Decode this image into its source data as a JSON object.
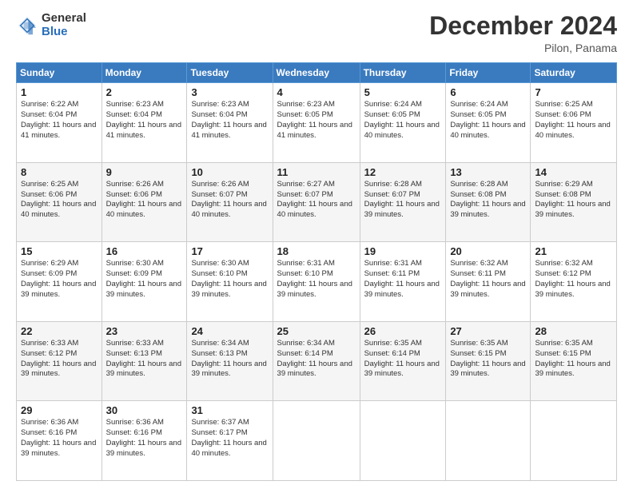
{
  "logo": {
    "general": "General",
    "blue": "Blue"
  },
  "title": "December 2024",
  "location": "Pilon, Panama",
  "days_of_week": [
    "Sunday",
    "Monday",
    "Tuesday",
    "Wednesday",
    "Thursday",
    "Friday",
    "Saturday"
  ],
  "weeks": [
    [
      {
        "day": "1",
        "sunrise": "6:22 AM",
        "sunset": "6:04 PM",
        "daylight": "11 hours and 41 minutes."
      },
      {
        "day": "2",
        "sunrise": "6:23 AM",
        "sunset": "6:04 PM",
        "daylight": "11 hours and 41 minutes."
      },
      {
        "day": "3",
        "sunrise": "6:23 AM",
        "sunset": "6:04 PM",
        "daylight": "11 hours and 41 minutes."
      },
      {
        "day": "4",
        "sunrise": "6:23 AM",
        "sunset": "6:05 PM",
        "daylight": "11 hours and 41 minutes."
      },
      {
        "day": "5",
        "sunrise": "6:24 AM",
        "sunset": "6:05 PM",
        "daylight": "11 hours and 40 minutes."
      },
      {
        "day": "6",
        "sunrise": "6:24 AM",
        "sunset": "6:05 PM",
        "daylight": "11 hours and 40 minutes."
      },
      {
        "day": "7",
        "sunrise": "6:25 AM",
        "sunset": "6:06 PM",
        "daylight": "11 hours and 40 minutes."
      }
    ],
    [
      {
        "day": "8",
        "sunrise": "6:25 AM",
        "sunset": "6:06 PM",
        "daylight": "11 hours and 40 minutes."
      },
      {
        "day": "9",
        "sunrise": "6:26 AM",
        "sunset": "6:06 PM",
        "daylight": "11 hours and 40 minutes."
      },
      {
        "day": "10",
        "sunrise": "6:26 AM",
        "sunset": "6:07 PM",
        "daylight": "11 hours and 40 minutes."
      },
      {
        "day": "11",
        "sunrise": "6:27 AM",
        "sunset": "6:07 PM",
        "daylight": "11 hours and 40 minutes."
      },
      {
        "day": "12",
        "sunrise": "6:28 AM",
        "sunset": "6:07 PM",
        "daylight": "11 hours and 39 minutes."
      },
      {
        "day": "13",
        "sunrise": "6:28 AM",
        "sunset": "6:08 PM",
        "daylight": "11 hours and 39 minutes."
      },
      {
        "day": "14",
        "sunrise": "6:29 AM",
        "sunset": "6:08 PM",
        "daylight": "11 hours and 39 minutes."
      }
    ],
    [
      {
        "day": "15",
        "sunrise": "6:29 AM",
        "sunset": "6:09 PM",
        "daylight": "11 hours and 39 minutes."
      },
      {
        "day": "16",
        "sunrise": "6:30 AM",
        "sunset": "6:09 PM",
        "daylight": "11 hours and 39 minutes."
      },
      {
        "day": "17",
        "sunrise": "6:30 AM",
        "sunset": "6:10 PM",
        "daylight": "11 hours and 39 minutes."
      },
      {
        "day": "18",
        "sunrise": "6:31 AM",
        "sunset": "6:10 PM",
        "daylight": "11 hours and 39 minutes."
      },
      {
        "day": "19",
        "sunrise": "6:31 AM",
        "sunset": "6:11 PM",
        "daylight": "11 hours and 39 minutes."
      },
      {
        "day": "20",
        "sunrise": "6:32 AM",
        "sunset": "6:11 PM",
        "daylight": "11 hours and 39 minutes."
      },
      {
        "day": "21",
        "sunrise": "6:32 AM",
        "sunset": "6:12 PM",
        "daylight": "11 hours and 39 minutes."
      }
    ],
    [
      {
        "day": "22",
        "sunrise": "6:33 AM",
        "sunset": "6:12 PM",
        "daylight": "11 hours and 39 minutes."
      },
      {
        "day": "23",
        "sunrise": "6:33 AM",
        "sunset": "6:13 PM",
        "daylight": "11 hours and 39 minutes."
      },
      {
        "day": "24",
        "sunrise": "6:34 AM",
        "sunset": "6:13 PM",
        "daylight": "11 hours and 39 minutes."
      },
      {
        "day": "25",
        "sunrise": "6:34 AM",
        "sunset": "6:14 PM",
        "daylight": "11 hours and 39 minutes."
      },
      {
        "day": "26",
        "sunrise": "6:35 AM",
        "sunset": "6:14 PM",
        "daylight": "11 hours and 39 minutes."
      },
      {
        "day": "27",
        "sunrise": "6:35 AM",
        "sunset": "6:15 PM",
        "daylight": "11 hours and 39 minutes."
      },
      {
        "day": "28",
        "sunrise": "6:35 AM",
        "sunset": "6:15 PM",
        "daylight": "11 hours and 39 minutes."
      }
    ],
    [
      {
        "day": "29",
        "sunrise": "6:36 AM",
        "sunset": "6:16 PM",
        "daylight": "11 hours and 39 minutes."
      },
      {
        "day": "30",
        "sunrise": "6:36 AM",
        "sunset": "6:16 PM",
        "daylight": "11 hours and 39 minutes."
      },
      {
        "day": "31",
        "sunrise": "6:37 AM",
        "sunset": "6:17 PM",
        "daylight": "11 hours and 40 minutes."
      },
      null,
      null,
      null,
      null
    ]
  ]
}
